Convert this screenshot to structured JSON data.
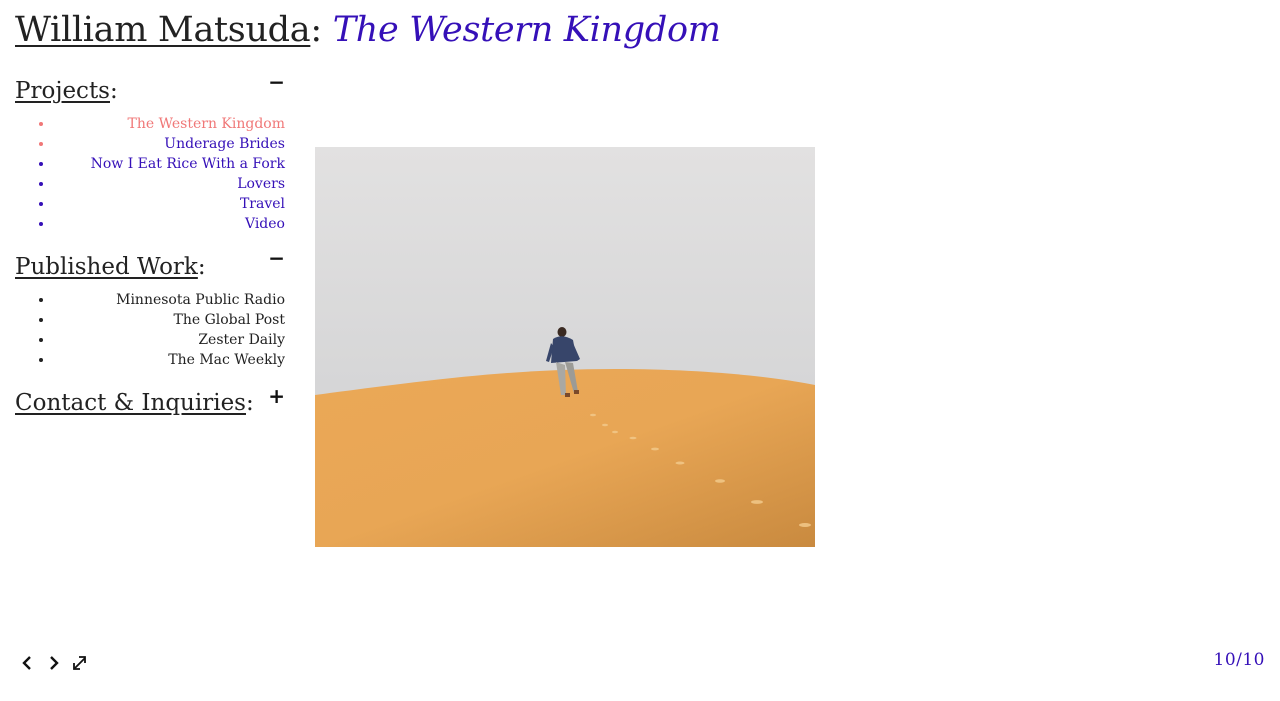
{
  "header": {
    "author": "William Matsuda",
    "separator": ":",
    "project_title": "The Western Kingdom"
  },
  "sidebar": {
    "projects": {
      "heading": "Projects",
      "toggle": "−",
      "items": [
        {
          "label": "The Western Kingdom"
        },
        {
          "label": "Underage Brides"
        },
        {
          "label": "Now I Eat Rice With a Fork"
        },
        {
          "label": "Lovers"
        },
        {
          "label": "Travel"
        },
        {
          "label": "Video"
        }
      ]
    },
    "published": {
      "heading": "Published Work",
      "toggle": "−",
      "items": [
        {
          "label": "Minnesota Public Radio"
        },
        {
          "label": "The Global Post"
        },
        {
          "label": "Zester Daily"
        },
        {
          "label": "The Mac Weekly"
        }
      ]
    },
    "contact": {
      "heading": "Contact & Inquiries",
      "toggle": "+"
    }
  },
  "viewer": {
    "counter": "10/10",
    "icons": [
      "chevron-left-icon",
      "chevron-right-icon",
      "fullscreen-icon"
    ]
  },
  "colors": {
    "link": "#3510b8",
    "active": "#f07878",
    "text": "#222222"
  }
}
